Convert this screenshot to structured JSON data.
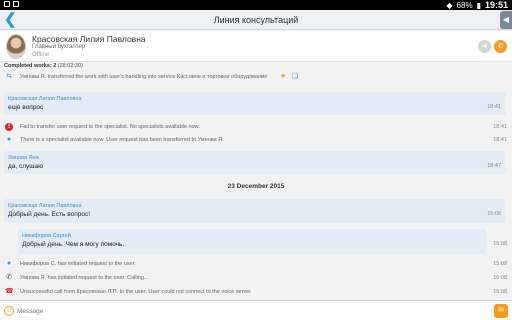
{
  "statusbar": {
    "battery": "68%",
    "time": "19:51"
  },
  "titlebar": {
    "title": "Линия консультаций"
  },
  "header": {
    "name": "Красовская Лилия Павловна",
    "position": "Главный бухгалтер",
    "status": "Offline"
  },
  "completed": {
    "label": "Completed works: 2",
    "time": "(28:02:30)"
  },
  "feed": {
    "sys1": {
      "text": "Умнова Я. transferred the work with user's handling into service Кассовое и торговое оборудование"
    },
    "b1": {
      "author": "Красовская Лилия Павловна",
      "message": "еще вопрос",
      "time": "18:41"
    },
    "sys2": {
      "text": "Fail to transfer user request to the specialist. No specialists available now.",
      "time": "18:41"
    },
    "sys3": {
      "text": "There is a specialist available now. User request has been transferred to Умнова Я.",
      "time": "18:41"
    },
    "b2": {
      "author": "Умнова Яна",
      "message": "да, слушаю",
      "time": "18:47"
    },
    "date": "23 December 2015",
    "b3": {
      "author": "Красовская Лилия Павловна",
      "message": "Добрый день. Есть вопрос!",
      "time": "15:08"
    },
    "b4": {
      "author": "Никифоров Сергей",
      "message": "Добрый день. Чем я могу помочь.",
      "time": "15:08"
    },
    "sys4": {
      "text": "Никифоров С. has initiated request to the user.",
      "time": "15:08"
    },
    "sys5": {
      "text": "Умнова Я. has initiated request to the user. Calling...",
      "time": "15:08"
    },
    "sys6": {
      "text": "Unsuccessful call from Красовская Л.П. to the user. User could not connect to the voice server",
      "time": "15:08"
    }
  },
  "composer": {
    "placeholder": "Message"
  }
}
